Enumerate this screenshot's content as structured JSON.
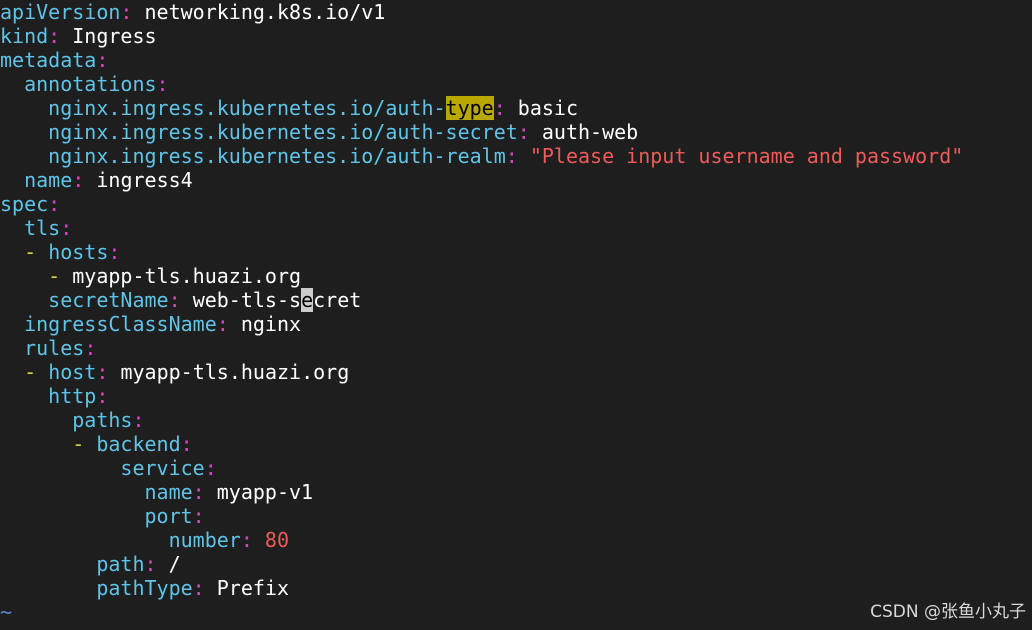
{
  "editor": {
    "lines": [
      {
        "indent": "",
        "key": "apiVersion",
        "value": "networking.k8s.io/v1"
      },
      {
        "indent": "",
        "key": "kind",
        "value": "Ingress"
      },
      {
        "indent": "",
        "key": "metadata",
        "value": ""
      },
      {
        "indent": "  ",
        "key": "annotations",
        "value": ""
      },
      {
        "indent": "    ",
        "key_pre": "nginx.ingress.kubernetes.io/auth-",
        "key_hl": "type",
        "value": "basic"
      },
      {
        "indent": "    ",
        "key": "nginx.ingress.kubernetes.io/auth-secret",
        "value": "auth-web"
      },
      {
        "indent": "    ",
        "key": "nginx.ingress.kubernetes.io/auth-realm",
        "value": "\"Please input username and password\""
      },
      {
        "indent": "  ",
        "key": "name",
        "value": "ingress4"
      },
      {
        "indent": "",
        "key": "spec",
        "value": ""
      },
      {
        "indent": "  ",
        "key": "tls",
        "value": ""
      },
      {
        "indent": "  ",
        "dash": "- ",
        "key": "hosts",
        "value": ""
      },
      {
        "indent": "    ",
        "dash": "- ",
        "value": "myapp-tls.huazi.org"
      },
      {
        "indent": "    ",
        "key": "secretName",
        "value_pre": "web-tls-s",
        "value_cursor": "e",
        "value_post": "cret"
      },
      {
        "indent": "  ",
        "key": "ingressClassName",
        "value": "nginx"
      },
      {
        "indent": "  ",
        "key": "rules",
        "value": ""
      },
      {
        "indent": "  ",
        "dash": "- ",
        "key": "host",
        "value": "myapp-tls.huazi.org"
      },
      {
        "indent": "    ",
        "key": "http",
        "value": ""
      },
      {
        "indent": "      ",
        "key": "paths",
        "value": ""
      },
      {
        "indent": "      ",
        "dash": "- ",
        "key": "backend",
        "value": ""
      },
      {
        "indent": "          ",
        "key": "service",
        "value": ""
      },
      {
        "indent": "            ",
        "key": "name",
        "value": "myapp-v1"
      },
      {
        "indent": "            ",
        "key": "port",
        "value": ""
      },
      {
        "indent": "              ",
        "key": "number",
        "value": "80"
      },
      {
        "indent": "        ",
        "key": "path",
        "value": "/"
      },
      {
        "indent": "        ",
        "key": "pathType",
        "value": "Prefix"
      }
    ],
    "empty_line_marker": "~",
    "colon": ":"
  },
  "watermark": "CSDN @张鱼小丸子"
}
